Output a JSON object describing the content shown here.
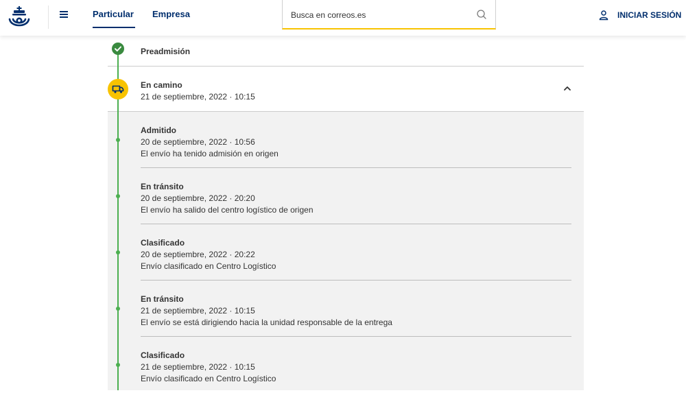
{
  "header": {
    "nav": [
      "Particular",
      "Empresa"
    ],
    "search_placeholder": "Busca en correos.es",
    "login_label": "INICIAR SESIÓN"
  },
  "stages": {
    "pre": {
      "title": "Preadmisión"
    },
    "camino": {
      "title": "En camino",
      "date": "21 de septiembre, 2022 · 10:15"
    }
  },
  "events": [
    {
      "title": "Admitido",
      "date": "20 de septiembre, 2022 · 10:56",
      "desc": "El envío ha tenido admisión en origen"
    },
    {
      "title": "En tránsito",
      "date": "20 de septiembre, 2022 · 20:20",
      "desc": "El envío ha salido del centro logístico de origen"
    },
    {
      "title": "Clasificado",
      "date": "20 de septiembre, 2022 · 20:22",
      "desc": "Envío clasificado en Centro Logístico"
    },
    {
      "title": "En tránsito",
      "date": "21 de septiembre, 2022 · 10:15",
      "desc": "El envío se está dirigiendo hacia la unidad responsable de la entrega"
    },
    {
      "title": "Clasificado",
      "date": "21 de septiembre, 2022 · 10:15",
      "desc": "Envío clasificado en Centro Logístico"
    }
  ],
  "colors": {
    "brand_blue": "#002e6d",
    "brand_yellow": "#f8c300",
    "timeline_green": "#4caf50",
    "check_green": "#3a8a3f"
  },
  "icons": [
    "correos-logo",
    "menu-icon",
    "search-icon",
    "user-icon",
    "check-icon",
    "truck-icon",
    "chevron-up-icon"
  ]
}
